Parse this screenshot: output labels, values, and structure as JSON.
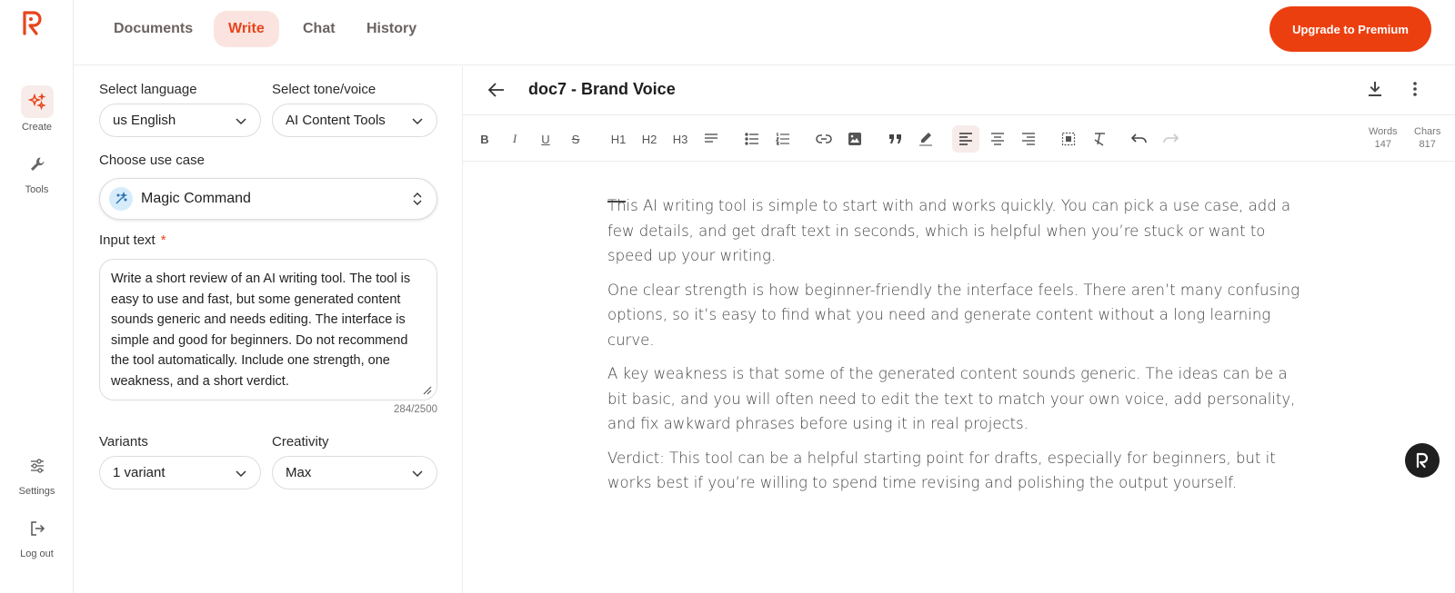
{
  "nav": {
    "tabs": [
      {
        "label": "Documents"
      },
      {
        "label": "Write"
      },
      {
        "label": "Chat"
      },
      {
        "label": "History"
      }
    ],
    "upgrade_label": "Upgrade to Premium"
  },
  "rail": {
    "create_label": "Create",
    "tools_label": "Tools",
    "settings_label": "Settings",
    "logout_label": "Log out"
  },
  "form": {
    "language_label": "Select language",
    "language_value": "us English",
    "tone_label": "Select tone/voice",
    "tone_value": "AI Content Tools",
    "usecase_label": "Choose use case",
    "usecase_value": "Magic Command",
    "input_label": "Input text",
    "required_mark": "*",
    "input_value": "Write a short review of an AI writing tool. The tool is easy to use and fast, but some generated content sounds generic and needs editing. The interface is simple and good for beginners. Do not recommend the tool automatically. Include one strength, one weakness, and a short verdict.",
    "char_counter": "284/2500",
    "variants_label": "Variants",
    "variants_value": "1 variant",
    "creativity_label": "Creativity",
    "creativity_value": "Max"
  },
  "editor": {
    "title": "doc7 - Brand Voice",
    "toolbar": {
      "bold": "B",
      "italic": "I",
      "underline": "U",
      "strike": "S",
      "h1": "H1",
      "h2": "H2",
      "h3": "H3"
    },
    "words_label": "Words",
    "words_value": "147",
    "chars_label": "Chars",
    "chars_value": "817",
    "paragraphs": [
      "This AI writing tool is simple to start with and works quickly. You can pick a use case, add a few details, and get draft text in seconds, which is helpful when you’re stuck or want to speed up your writing.",
      "One clear strength is how beginner-friendly the interface feels. There aren’t many confusing options, so it’s easy to find what you need and generate content without a long learning curve.",
      "A key weakness is that some of the generated content sounds generic. The ideas can be a bit basic, and you will often need to edit the text to match your own voice, add personality, and fix awkward phrases before using it in real projects.",
      "Verdict: This tool can be a helpful starting point for drafts, especially for beginners, but it works best if you’re willing to spend time revising and polishing the output yourself."
    ]
  },
  "colors": {
    "accent": "#ec3f0f",
    "accent_soft": "#fbe4df",
    "border": "#dcdcdc"
  }
}
